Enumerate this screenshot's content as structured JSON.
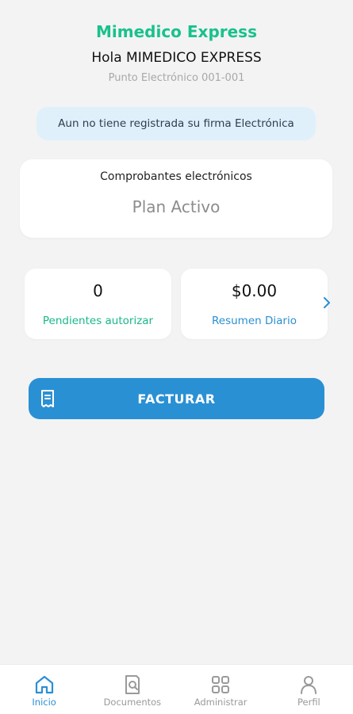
{
  "header": {
    "brand": "Mimedico Express",
    "greeting": "Hola MIMEDICO EXPRESS",
    "point": "Punto Electrónico 001-001"
  },
  "alert": {
    "text": "Aun no tiene registrada su firma Electrónica"
  },
  "plan": {
    "title": "Comprobantes electrónicos",
    "value": "Plan Activo"
  },
  "stats": {
    "pending": {
      "value": "0",
      "label": "Pendientes autorizar"
    },
    "daily": {
      "value": "$0.00",
      "label": "Resumen Diario"
    }
  },
  "action": {
    "label": "FACTURAR",
    "icon": "receipt-icon"
  },
  "nav": {
    "items": [
      {
        "label": "Inicio",
        "icon": "home-icon",
        "active": true
      },
      {
        "label": "Documentos",
        "icon": "document-search-icon"
      },
      {
        "label": "Administrar",
        "icon": "grid-icon"
      },
      {
        "label": "Perfil",
        "icon": "user-icon"
      }
    ]
  },
  "colors": {
    "brand": "#19c18c",
    "accent": "#2a90d4",
    "alert_bg": "#dff0fb"
  }
}
